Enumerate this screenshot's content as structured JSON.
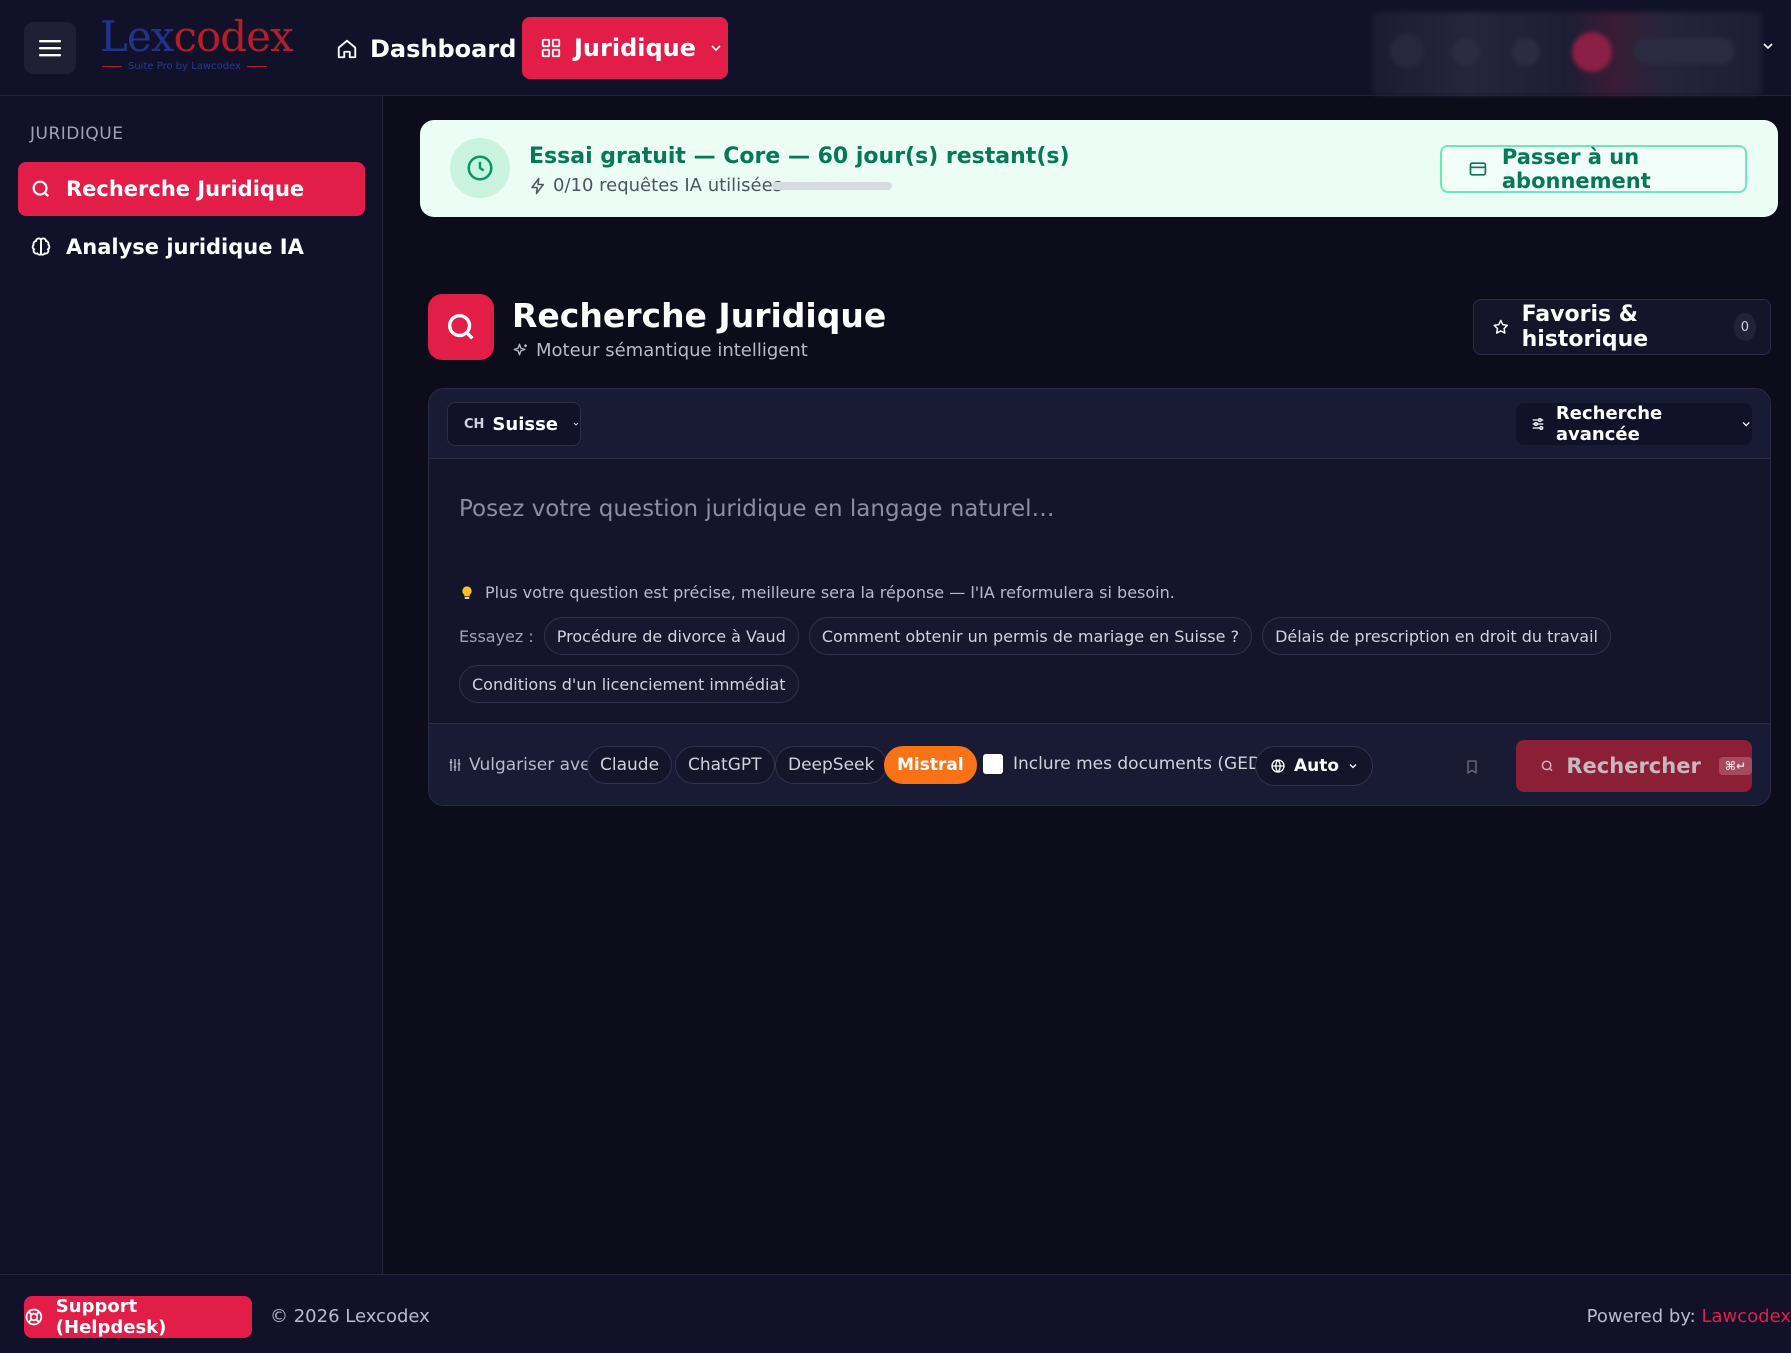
{
  "header": {
    "logo": {
      "part1": "Lex",
      "part2": "codex",
      "subtitle": "Suite Pro by Lawcodex"
    },
    "nav": {
      "dashboard": "Dashboard",
      "juridique": "Juridique"
    }
  },
  "sidebar": {
    "heading": "JURIDIQUE",
    "items": [
      {
        "label": "Recherche Juridique",
        "icon": "search-icon",
        "active": true
      },
      {
        "label": "Analyse juridique IA",
        "icon": "brain-icon",
        "active": false
      }
    ]
  },
  "trial": {
    "title": "Essai gratuit — Core — 60 jour(s) restant(s)",
    "usage": "0/10 requêtes IA utilisées",
    "usage_fraction": 0,
    "subscribe_label": "Passer à un abonnement"
  },
  "page": {
    "title": "Recherche Juridique",
    "subtitle": "Moteur sémantique intelligent",
    "favorites_label": "Favoris & historique",
    "favorites_count": "0"
  },
  "search": {
    "country_code": "CH",
    "country": "Suisse",
    "advanced_label": "Recherche avancée",
    "placeholder": "Posez votre question juridique en langage naturel…",
    "tip": "Plus votre question est précise, meilleure sera la réponse — l'IA reformulera si besoin.",
    "try_label": "Essayez :",
    "suggestions": [
      "Procédure de divorce à Vaud",
      "Comment obtenir un permis de mariage en Suisse ?",
      "Délais de prescription en droit du travail",
      "Conditions d'un licenciement immédiat"
    ],
    "vulgarize_label": "Vulgariser avec",
    "models": [
      "Claude",
      "ChatGPT",
      "DeepSeek",
      "Mistral"
    ],
    "selected_model": "Mistral",
    "ged_label": "Inclure mes documents (GED)",
    "language_mode": "Auto",
    "submit_label": "Rechercher",
    "shortcut": "⌘↵"
  },
  "footer": {
    "support_label": "Support (Helpdesk)",
    "copyright": "© 2026 Lexcodex",
    "powered_prefix": "Powered by: ",
    "powered_brand": "Lawcodex"
  },
  "colors": {
    "accent": "#e11d48",
    "background": "#0c0c1a",
    "panel": "#11122a",
    "trial_bg": "#ecfdf5",
    "trial_text": "#047857",
    "model_active": "#f97316"
  }
}
